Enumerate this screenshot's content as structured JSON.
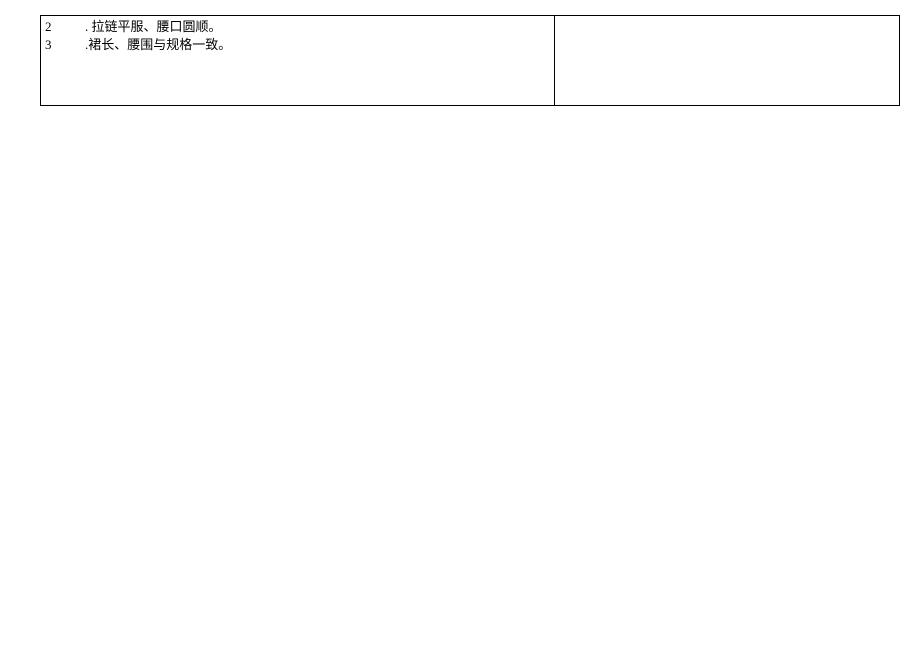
{
  "table": {
    "rows": [
      {
        "num": "2",
        "text": ". 拉链平服、腰口圆顺。"
      },
      {
        "num": "3",
        "text": ".裙长、腰围与规格一致。"
      }
    ]
  }
}
